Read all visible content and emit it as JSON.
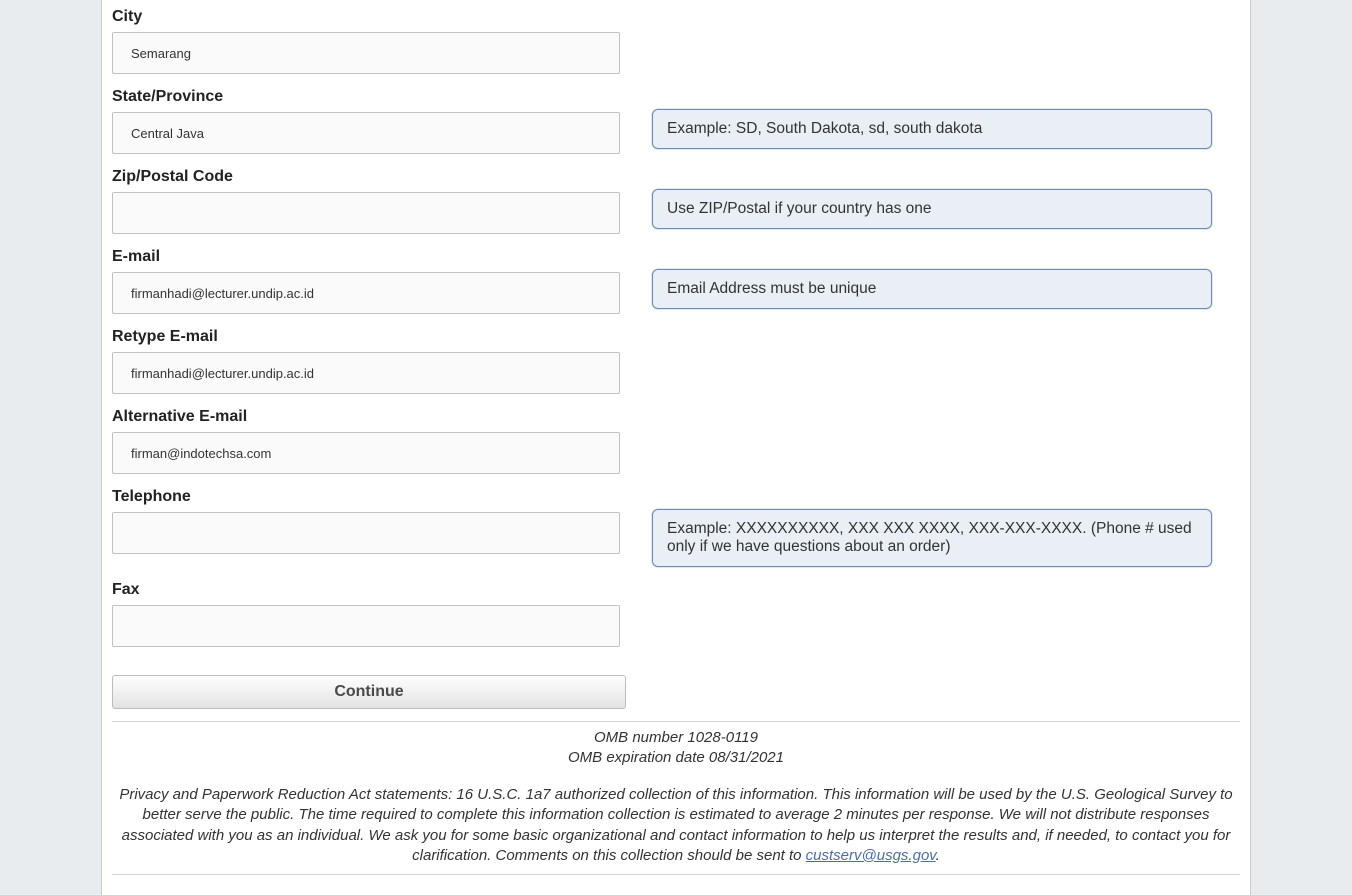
{
  "form": {
    "city": {
      "label": "City",
      "value": "Semarang"
    },
    "state": {
      "label": "State/Province",
      "value": "Central Java",
      "hint": "Example: SD, South Dakota, sd, south dakota"
    },
    "zip": {
      "label": "Zip/Postal Code",
      "value": "",
      "hint": "Use ZIP/Postal if your country has one"
    },
    "email": {
      "label": "E-mail",
      "value": "firmanhadi@lecturer.undip.ac.id",
      "hint": "Email Address must be unique"
    },
    "retype_email": {
      "label": "Retype E-mail",
      "value": "firmanhadi@lecturer.undip.ac.id"
    },
    "alt_email": {
      "label": "Alternative E-mail",
      "value": "firman@indotechsa.com"
    },
    "telephone": {
      "label": "Telephone",
      "value": "",
      "hint": "Example: XXXXXXXXXX, XXX XXX XXXX, XXX-XXX-XXXX. (Phone # used only if we have questions about an order)"
    },
    "fax": {
      "label": "Fax",
      "value": ""
    },
    "continue_label": "Continue"
  },
  "footer": {
    "omb_number": "OMB number 1028-0119",
    "omb_expiration": "OMB expiration date 08/31/2021",
    "privacy_text_1": "Privacy and Paperwork Reduction Act statements: 16 U.S.C. 1a7 authorized collection of this information. This information will be used by the U.S. Geological Survey to better serve the public. The time required to complete this information collection is estimated to average 2 minutes per response. We will not distribute responses associated with you as an individual. We ask you for some basic organizational and contact information to help us interpret the results and, if needed, to contact you for clarification. Comments on this collection should be sent to ",
    "privacy_email": "custserv@usgs.gov",
    "privacy_text_2": "."
  }
}
